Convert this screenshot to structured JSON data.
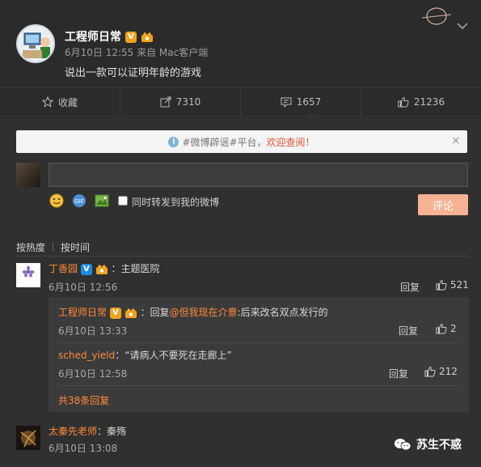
{
  "post": {
    "author": "工程师日常",
    "meta": "6月10日 12:55 来自 Mac客户端",
    "text": "说出一款可以证明年龄的游戏",
    "verified_badge": "V"
  },
  "actions": [
    {
      "icon": "star-icon",
      "label": "收藏"
    },
    {
      "icon": "share-icon",
      "label": "7310"
    },
    {
      "icon": "comment-icon",
      "label": "1657"
    },
    {
      "icon": "like-icon",
      "label": "21236"
    }
  ],
  "notice": {
    "prefix": "#微博辟谣#平台，",
    "link": "欢迎查阅！",
    "close": "×"
  },
  "composer": {
    "forward_label": "同时转发到我的微博",
    "submit_label": "评论"
  },
  "sort": {
    "hot": "按热度",
    "time": "按时间"
  },
  "comments": [
    {
      "user": "丁香园",
      "badge": "V",
      "text": "：主题医院",
      "time": "6月10日 12:56",
      "reply": "回复",
      "likes": "521",
      "avatar_caption": "丁香园"
    },
    {
      "user": "太秦先老师",
      "text": "：秦殇",
      "time": "6月10日 13:08"
    }
  ],
  "replies": [
    {
      "user": "工程师日常",
      "badge": "V",
      "prefix": "：回复",
      "mention": "@但我现在介意",
      "text": ":后来改名双点发行的",
      "time": "6月10日 13:33",
      "reply": "回复",
      "likes": "2"
    },
    {
      "user": "sched_yield",
      "text": "：“请病人不要死在走廊上”",
      "time": "6月10日 12:58",
      "reply": "回复",
      "likes": "212"
    }
  ],
  "more_replies": "共38条回复",
  "watermark": {
    "text": "苏生不惑"
  },
  "colors": {
    "accent": "#ff8a3a",
    "submit": "#f7b193",
    "link": "#e2533b"
  }
}
